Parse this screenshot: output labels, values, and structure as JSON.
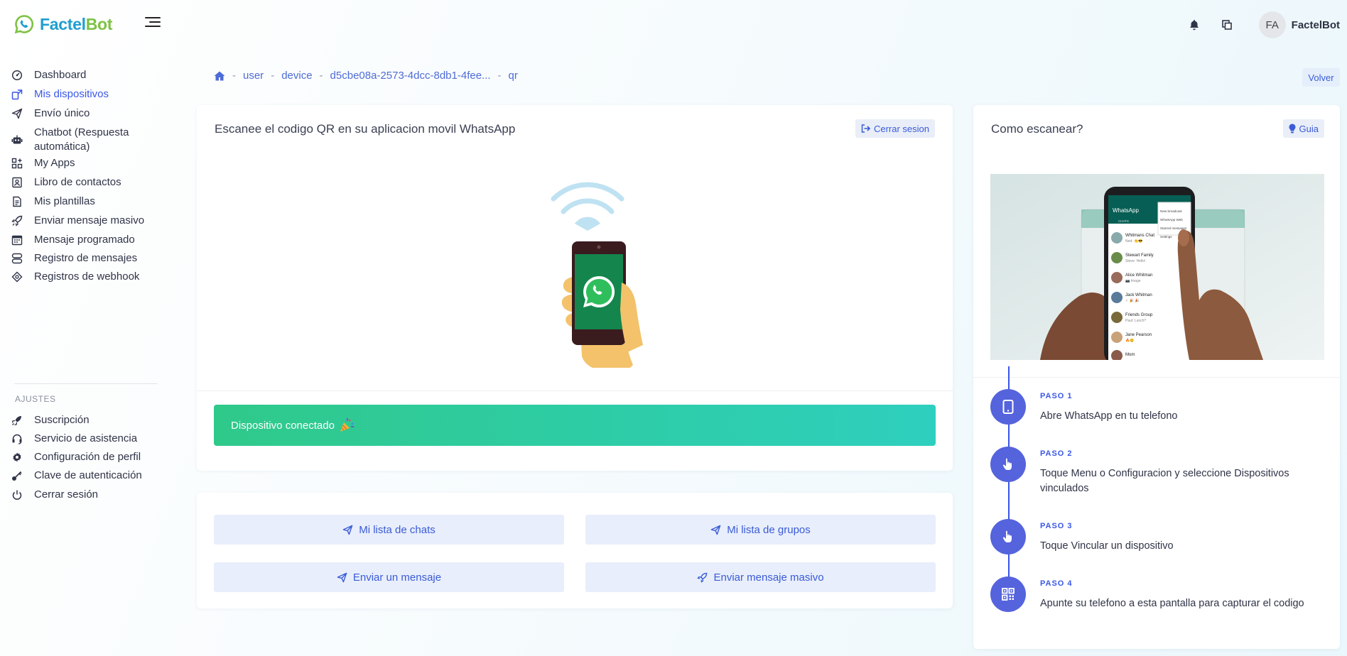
{
  "brand": {
    "name_part1": "Factel",
    "name_part2": "Bot"
  },
  "topbar": {
    "avatar_initials": "FA",
    "user_name": "FactelBot"
  },
  "sidebar": {
    "items": [
      {
        "label": "Dashboard",
        "icon": "dashboard-icon"
      },
      {
        "label": "Mis dispositivos",
        "icon": "devices-icon",
        "active": true
      },
      {
        "label": "Envío único",
        "icon": "send-icon"
      },
      {
        "label": "Chatbot (Respuesta automática)",
        "icon": "robot-icon"
      },
      {
        "label": "My Apps",
        "icon": "apps-icon"
      },
      {
        "label": "Libro de contactos",
        "icon": "contacts-book-icon"
      },
      {
        "label": "Mis plantillas",
        "icon": "template-icon"
      },
      {
        "label": "Enviar mensaje masivo",
        "icon": "rocket-icon"
      },
      {
        "label": "Mensaje programado",
        "icon": "calendar-icon"
      },
      {
        "label": "Registro de mensajes",
        "icon": "message-log-icon"
      },
      {
        "label": "Registros de webhook",
        "icon": "webhook-icon"
      }
    ],
    "settings_title": "AJUSTES",
    "settings_items": [
      {
        "label": "Suscripción",
        "icon": "subscription-icon"
      },
      {
        "label": "Servicio de asistencia",
        "icon": "headset-icon"
      },
      {
        "label": "Configuración de perfil",
        "icon": "gear-icon"
      },
      {
        "label": "Clave de autenticación",
        "icon": "key-icon"
      },
      {
        "label": "Cerrar sesión",
        "icon": "power-icon"
      }
    ]
  },
  "breadcrumb": {
    "items": [
      "user",
      "device",
      "d5cbe08a-2573-4dcc-8db1-4fee...",
      "qr"
    ]
  },
  "volver_label": "Volver",
  "qr_card": {
    "title": "Escanee el codigo QR en su aplicacion movil WhatsApp",
    "logout_label": "Cerrar sesion",
    "status_text": "Dispositivo conectado"
  },
  "actions": {
    "chats": "Mi lista de chats",
    "groups": "Mi lista de grupos",
    "send": "Enviar un mensaje",
    "bulk": "Enviar mensaje masivo"
  },
  "guide_card": {
    "title": "Como escanear?",
    "guide_label": "Guia",
    "phone_app": "WhatsApp",
    "phone_tab": "CHATS",
    "phone_menu": [
      "New broadcast",
      "WhatsApp Web",
      "Starred messages",
      "Settings"
    ],
    "phone_chats": [
      {
        "name": "Whitmans Chat",
        "msg": "Ned: 👏😎"
      },
      {
        "name": "Stewart Family",
        "msg": "Steve: Hello!"
      },
      {
        "name": "Alice Whitman",
        "msg": "📷 Image"
      },
      {
        "name": "Jack Whitman",
        "msg": "✓ 🎉 🎉"
      },
      {
        "name": "Friends Group",
        "msg": "Paul: Lunch?"
      },
      {
        "name": "Jane Pearson",
        "msg": "🔥😊"
      },
      {
        "name": "Mom",
        "msg": ""
      }
    ],
    "steps": [
      {
        "label": "PASO 1",
        "text": "Abre WhatsApp en tu telefono",
        "icon": "tablet-icon"
      },
      {
        "label": "PASO 2",
        "text": "Toque Menu o Configuracion y seleccione Dispositivos vinculados",
        "icon": "hand-pointer-icon"
      },
      {
        "label": "PASO 3",
        "text": "Toque Vincular un dispositivo",
        "icon": "hand-pointer-icon"
      },
      {
        "label": "PASO 4",
        "text": "Apunte su telefono a esta pantalla para capturar el codigo",
        "icon": "qr-code-icon"
      }
    ]
  },
  "colors": {
    "primary": "#3a57e8",
    "brand_blue": "#1f9fcf",
    "brand_green": "#7dc242",
    "success_start": "#2fc98a",
    "success_end": "#2ecfbe",
    "step_circle": "#5563dd"
  }
}
